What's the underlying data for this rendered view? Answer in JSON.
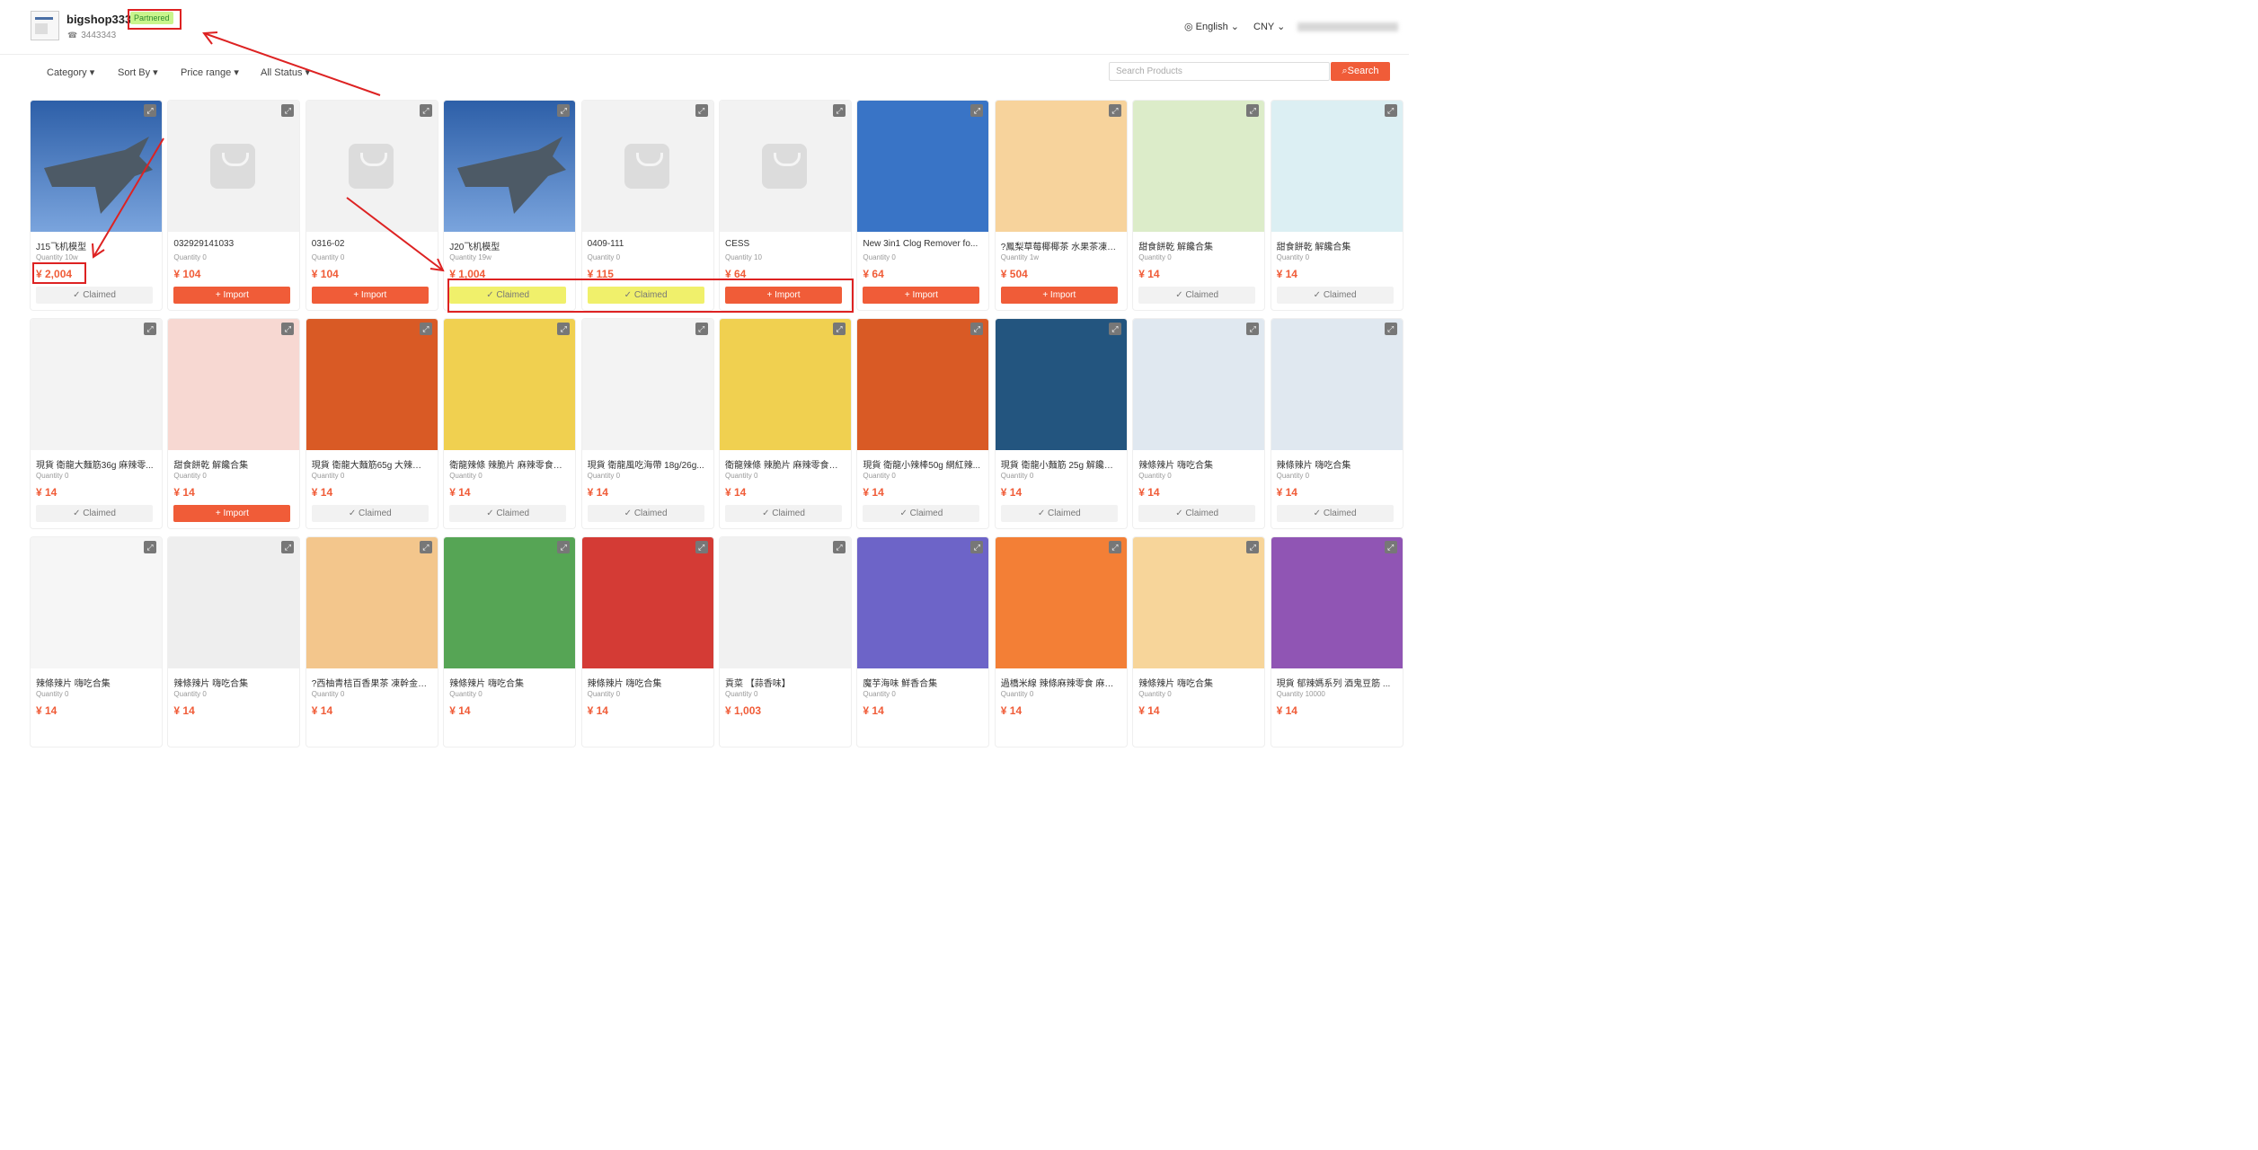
{
  "header": {
    "shop_name": "bigshop333",
    "badge": "Partnered",
    "phone": "3443343",
    "language": "English",
    "currency": "CNY"
  },
  "filters": {
    "category": "Category",
    "sort_by": "Sort By",
    "price_range": "Price range",
    "status": "All Status"
  },
  "search": {
    "placeholder": "Search Products",
    "button": "Search"
  },
  "products": [
    {
      "title": "J15飞机模型",
      "qty": "Quantity 10w",
      "price": "¥ 2,004",
      "action": "Claimed"
    },
    {
      "title": "032929141033",
      "qty": "Quantity 0",
      "price": "¥ 104",
      "action": "+ Import"
    },
    {
      "title": "0316-02",
      "qty": "Quantity 0",
      "price": "¥ 104",
      "action": "+ Import"
    },
    {
      "title": "J20飞机模型",
      "qty": "Quantity 19w",
      "price": "¥ 1,004",
      "action": "Claimed"
    },
    {
      "title": "0409-111",
      "qty": "Quantity 0",
      "price": "¥ 115",
      "action": "Claimed"
    },
    {
      "title": "CESS",
      "qty": "Quantity 10",
      "price": "¥ 64",
      "action": "+ Import"
    },
    {
      "title": "New 3in1 Clog Remover fo...",
      "qty": "Quantity 0",
      "price": "¥ 64",
      "action": "+ Import"
    },
    {
      "title": "?鳳梨草莓椰椰茶 水果茶凍幹...",
      "qty": "Quantity 1w",
      "price": "¥ 504",
      "action": "+ Import"
    },
    {
      "title": "甜食餅乾 解饞合集",
      "qty": "Quantity 0",
      "price": "¥ 14",
      "action": "Claimed"
    },
    {
      "title": "甜食餅乾 解饞合集",
      "qty": "Quantity 0",
      "price": "¥ 14",
      "action": "Claimed"
    },
    {
      "title": "現貨 衛龍大麵筋36g 麻辣零...",
      "qty": "Quantity 0",
      "price": "¥ 14",
      "action": "Claimed"
    },
    {
      "title": "甜食餅乾 解饞合集",
      "qty": "Quantity 0",
      "price": "¥ 14",
      "action": "+ Import"
    },
    {
      "title": "現貨 衛龍大麵筋65g 大辣條 ...",
      "qty": "Quantity 0",
      "price": "¥ 14",
      "action": "Claimed"
    },
    {
      "title": "衛龍辣條 辣脆片 麻辣零食辣...",
      "qty": "Quantity 0",
      "price": "¥ 14",
      "action": "Claimed"
    },
    {
      "title": "現貨 衛龍風吃海帶 18g/26g...",
      "qty": "Quantity 0",
      "price": "¥ 14",
      "action": "Claimed"
    },
    {
      "title": "衛龍辣條 辣脆片 麻辣零食辣...",
      "qty": "Quantity 0",
      "price": "¥ 14",
      "action": "Claimed"
    },
    {
      "title": "現貨 衛龍小辣棒50g 網紅辣...",
      "qty": "Quantity 0",
      "price": "¥ 14",
      "action": "Claimed"
    },
    {
      "title": "現貨 衛龍小麵筋 25g 解饞小...",
      "qty": "Quantity 0",
      "price": "¥ 14",
      "action": "Claimed"
    },
    {
      "title": "辣條辣片 嗨吃合集",
      "qty": "Quantity 0",
      "price": "¥ 14",
      "action": "Claimed"
    },
    {
      "title": "辣條辣片 嗨吃合集",
      "qty": "Quantity 0",
      "price": "¥ 14",
      "action": "Claimed"
    },
    {
      "title": "辣條辣片 嗨吃合集",
      "qty": "Quantity 0",
      "price": "¥ 14",
      "action": ""
    },
    {
      "title": "辣條辣片 嗨吃合集",
      "qty": "Quantity 0",
      "price": "¥ 14",
      "action": ""
    },
    {
      "title": "?西柚青桔百香果茶 凍幹金桔...",
      "qty": "Quantity 0",
      "price": "¥ 14",
      "action": ""
    },
    {
      "title": "辣條辣片 嗨吃合集",
      "qty": "Quantity 0",
      "price": "¥ 14",
      "action": ""
    },
    {
      "title": "辣條辣片 嗨吃合集",
      "qty": "Quantity 0",
      "price": "¥ 14",
      "action": ""
    },
    {
      "title": "貢菜 【蒜香味】",
      "qty": "Quantity 0",
      "price": "¥ 1,003",
      "action": ""
    },
    {
      "title": "魔芋海味 鮮香合集",
      "qty": "Quantity 0",
      "price": "¥ 14",
      "action": ""
    },
    {
      "title": "過橋米線 辣條麻辣零食 麻辣棒",
      "qty": "Quantity 0",
      "price": "¥ 14",
      "action": ""
    },
    {
      "title": "辣條辣片 嗨吃合集",
      "qty": "Quantity 0",
      "price": "¥ 14",
      "action": ""
    },
    {
      "title": "現貨 郁辣媽系列 酒鬼豆筋 ...",
      "qty": "Quantity 10000",
      "price": "¥ 14",
      "action": ""
    }
  ],
  "colors": {
    "accent": "#f05c38",
    "annotation": "#dd2222",
    "highlight": "#f0f06b"
  }
}
